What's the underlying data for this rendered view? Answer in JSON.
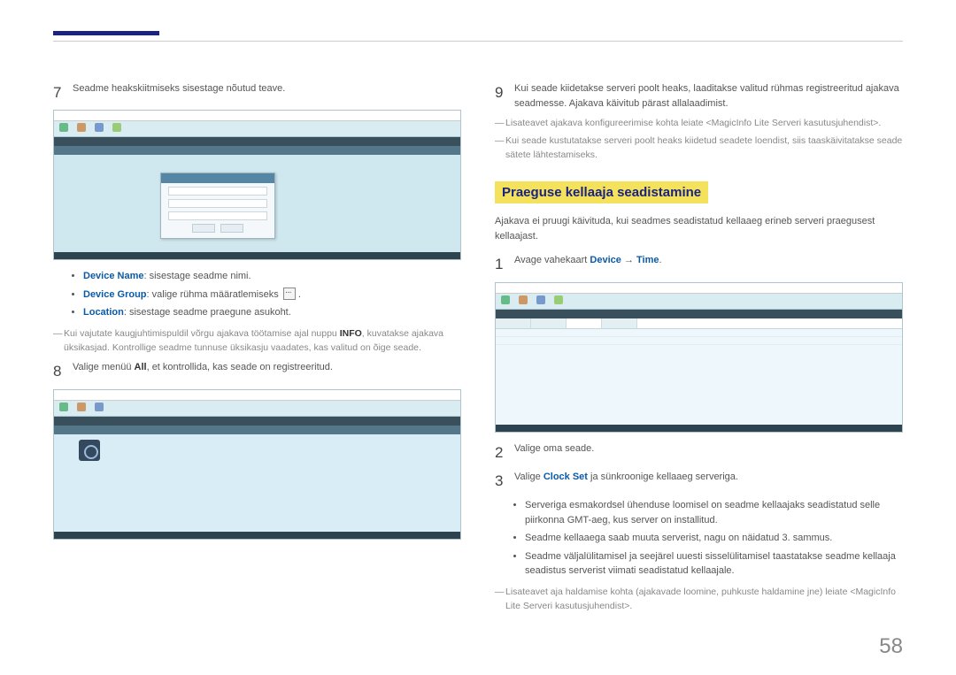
{
  "left": {
    "step7": {
      "num": "7",
      "text": "Seadme heakskiitmiseks sisestage nõutud teave."
    },
    "bullets": {
      "b1_label": "Device Name",
      "b1_text": ": sisestage seadme nimi.",
      "b2_label": "Device Group",
      "b2_text": ": valige rühma määratlemiseks ",
      "b3_label": "Location",
      "b3_text": ": sisestage seadme praegune asukoht."
    },
    "note1a": "Kui vajutate kaugjuhtimispuldil võrgu ajakava töötamise ajal nuppu ",
    "note1_bold": "INFO",
    "note1b": ", kuvatakse ajakava üksikasjad. Kontrollige seadme tunnuse üksikasju vaadates, kas valitud on õige seade.",
    "step8": {
      "num": "8",
      "text_a": "Valige menüü ",
      "bold": "All",
      "text_b": ", et kontrollida, kas seade on registreeritud."
    }
  },
  "right": {
    "step9": {
      "num": "9",
      "text": "Kui seade kiidetakse serveri poolt heaks, laaditakse valitud rühmas registreeritud ajakava seadmesse. Ajakava käivitub pärast allalaadimist."
    },
    "note_r1": "Lisateavet ajakava konfigureerimise kohta leiate <MagicInfo Lite Serveri kasutusjuhendist>.",
    "note_r2": "Kui seade kustutatakse serveri poolt heaks kiidetud seadete loendist, siis taaskäivitatakse seade sätete lähtestamiseks.",
    "heading": "Praeguse kellaaja seadistamine",
    "intro": "Ajakava ei pruugi käivituda, kui seadmes seadistatud kellaaeg erineb serveri praegusest kellaajast.",
    "step1": {
      "num": "1",
      "text_a": "Avage vahekaart ",
      "blue1": "Device",
      "arrow": " → ",
      "blue2": "Time",
      "dot": "."
    },
    "step2": {
      "num": "2",
      "text": "Valige oma seade."
    },
    "step3": {
      "num": "3",
      "text_a": "Valige ",
      "blue": "Clock Set",
      "text_b": " ja sünkroonige kellaaeg serveriga."
    },
    "endbullets": {
      "e1": "Serveriga esmakordsel ühenduse loomisel on seadme kellaajaks seadistatud selle piirkonna GMT-aeg, kus server on installitud.",
      "e2": "Seadme kellaaega saab muuta serverist, nagu on näidatud 3. sammus.",
      "e3": "Seadme väljalülitamisel ja seejärel uuesti sisselülitamisel taastatakse seadme kellaaja seadistus serverist viimati seadistatud kellaajale."
    },
    "note_end": "Lisateavet aja haldamise kohta (ajakavade loomine, puhkuste haldamine jne) leiate <MagicInfo Lite Serveri kasutusjuhendist>."
  },
  "pagenum": "58"
}
